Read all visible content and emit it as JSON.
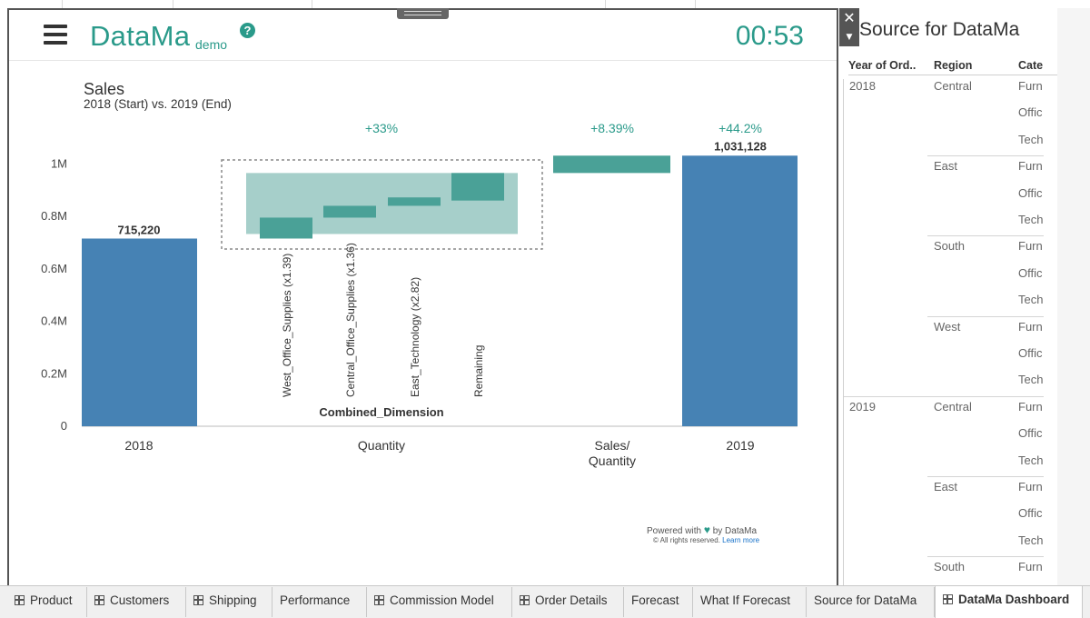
{
  "app": {
    "brand": "DataMa",
    "brand_sub": "demo",
    "help_glyph": "?",
    "timer": "00:53",
    "accent_color": "#2a9a8a",
    "bar_color": "#4682b4"
  },
  "chart_data": {
    "type": "bar",
    "title": "Sales",
    "subtitle": "2018 (Start) vs. 2019 (End)",
    "ylim": [
      0,
      1150000
    ],
    "yticks": [
      {
        "value": 0,
        "label": "0"
      },
      {
        "value": 200000,
        "label": "0.2M"
      },
      {
        "value": 400000,
        "label": "0.4M"
      },
      {
        "value": 600000,
        "label": "0.6M"
      },
      {
        "value": 800000,
        "label": "0.8M"
      },
      {
        "value": 1000000,
        "label": "1M"
      }
    ],
    "start": {
      "label": "2018",
      "value": 715220,
      "value_label": "715,220"
    },
    "end": {
      "label": "2019",
      "value": 1031128,
      "value_label": "1,031,128",
      "pct_label": "+44.2%"
    },
    "quantity_group": {
      "label": "Quantity",
      "pct_label": "+33%",
      "xlabel": "Combined_Dimension",
      "from": 715220,
      "to": 965000,
      "steps": [
        {
          "name": "West_Office_Supplies (x1.39)",
          "from": 715220,
          "to": 795000
        },
        {
          "name": "Central_Office_Supplies (x1.36)",
          "from": 795000,
          "to": 840000
        },
        {
          "name": "East_Technology (x2.82)",
          "from": 840000,
          "to": 872000
        },
        {
          "name": "Remaining",
          "from": 860000,
          "to": 965000
        }
      ]
    },
    "sales_per_quantity": {
      "label": "Sales/\nQuantity",
      "label_line1": "Sales/",
      "label_line2": "Quantity",
      "pct_label": "+8.39%",
      "from": 965000,
      "to": 1031128
    }
  },
  "footer": {
    "powered_by_prefix": "Powered with",
    "powered_by_suffix": "by DataMa",
    "rights": "© All rights reserved.",
    "learn_more": "Learn more"
  },
  "right_sheet": {
    "title": "Source for DataMa",
    "columns": [
      "Year of Ord..",
      "Region",
      "Cate"
    ],
    "years": [
      {
        "year": "2018",
        "regions": [
          {
            "region": "Central",
            "cats": [
              "Furn",
              "Offic",
              "Tech"
            ]
          },
          {
            "region": "East",
            "cats": [
              "Furn",
              "Offic",
              "Tech"
            ]
          },
          {
            "region": "South",
            "cats": [
              "Furn",
              "Offic",
              "Tech"
            ]
          },
          {
            "region": "West",
            "cats": [
              "Furn",
              "Offic",
              "Tech"
            ]
          }
        ]
      },
      {
        "year": "2019",
        "regions": [
          {
            "region": "Central",
            "cats": [
              "Furn",
              "Offic",
              "Tech"
            ]
          },
          {
            "region": "East",
            "cats": [
              "Furn",
              "Offic",
              "Tech"
            ]
          },
          {
            "region": "South",
            "cats": [
              "Furn"
            ]
          }
        ]
      }
    ]
  },
  "tabs": [
    {
      "label": "Product",
      "icon": "grid-icon"
    },
    {
      "label": "Customers",
      "icon": "grid-icon"
    },
    {
      "label": "Shipping",
      "icon": "grid-icon"
    },
    {
      "label": "Performance",
      "icon": ""
    },
    {
      "label": "Commission Model",
      "icon": "grid-icon"
    },
    {
      "label": "Order Details",
      "icon": "grid-icon"
    },
    {
      "label": "Forecast",
      "icon": ""
    },
    {
      "label": "What If Forecast",
      "icon": ""
    },
    {
      "label": "Source for DataMa",
      "icon": ""
    },
    {
      "label": "DataMa Dashboard",
      "icon": "grid-icon",
      "active": true
    }
  ],
  "controls": {
    "close_glyph": "✕",
    "dropdown_glyph": "▼"
  }
}
